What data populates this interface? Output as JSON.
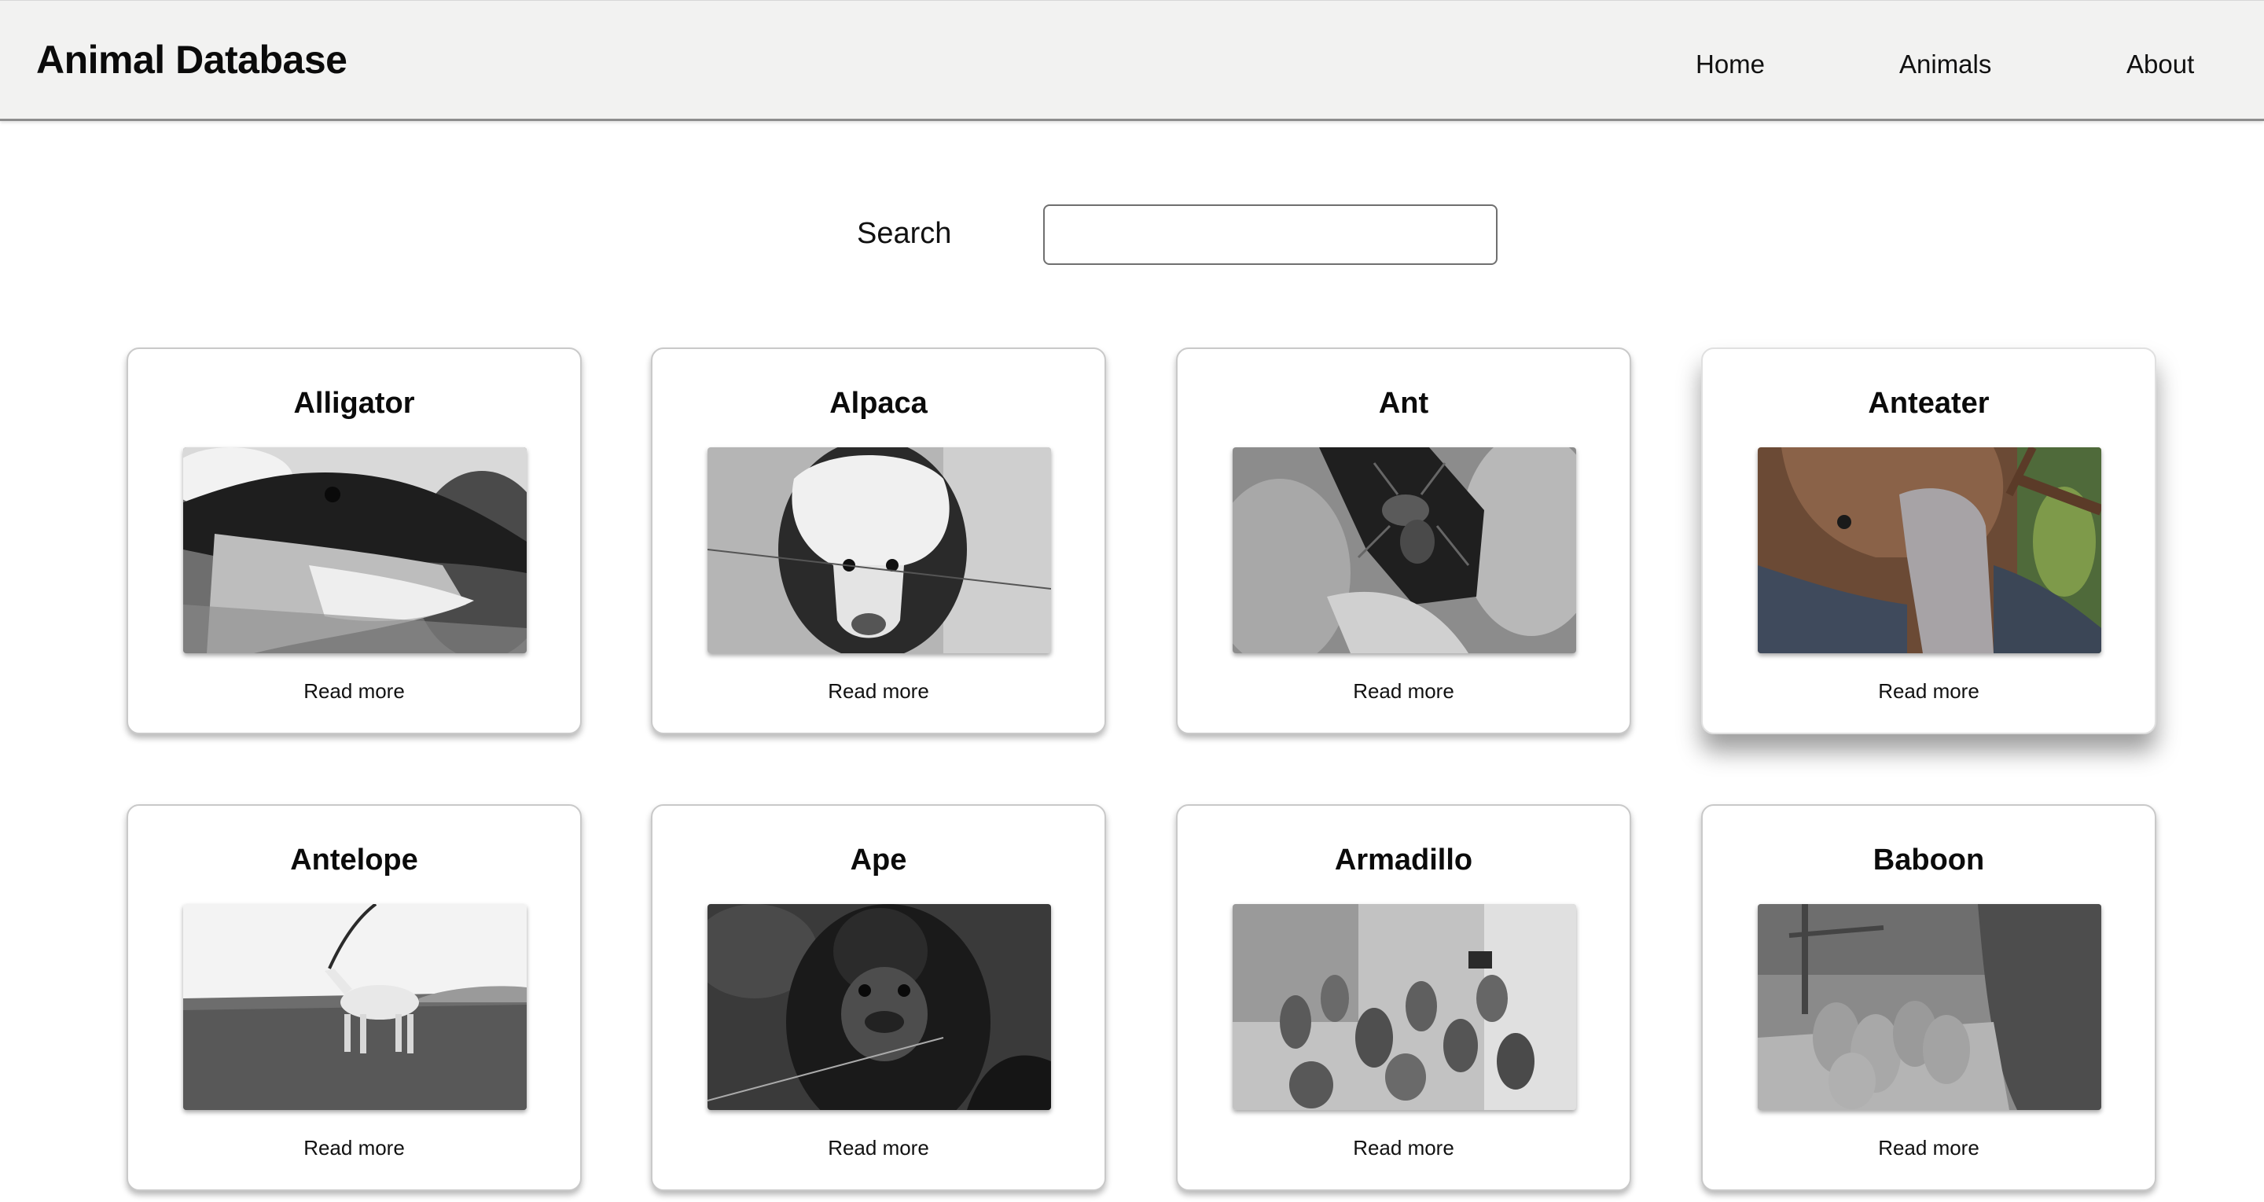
{
  "header": {
    "title": "Animal Database",
    "nav": [
      "Home",
      "Animals",
      "About"
    ]
  },
  "search": {
    "label": "Search",
    "value": "",
    "placeholder": ""
  },
  "cards": [
    {
      "name": "Alligator",
      "link": "Read more",
      "image": "alligator-photo"
    },
    {
      "name": "Alpaca",
      "link": "Read more",
      "image": "alpaca-photo"
    },
    {
      "name": "Ant",
      "link": "Read more",
      "image": "ant-photo"
    },
    {
      "name": "Anteater",
      "link": "Read more",
      "image": "anteater-photo"
    },
    {
      "name": "Antelope",
      "link": "Read more",
      "image": "antelope-photo"
    },
    {
      "name": "Ape",
      "link": "Read more",
      "image": "ape-photo"
    },
    {
      "name": "Armadillo",
      "link": "Read more",
      "image": "armadillo-photo"
    },
    {
      "name": "Baboon",
      "link": "Read more",
      "image": "baboon-photo"
    }
  ]
}
